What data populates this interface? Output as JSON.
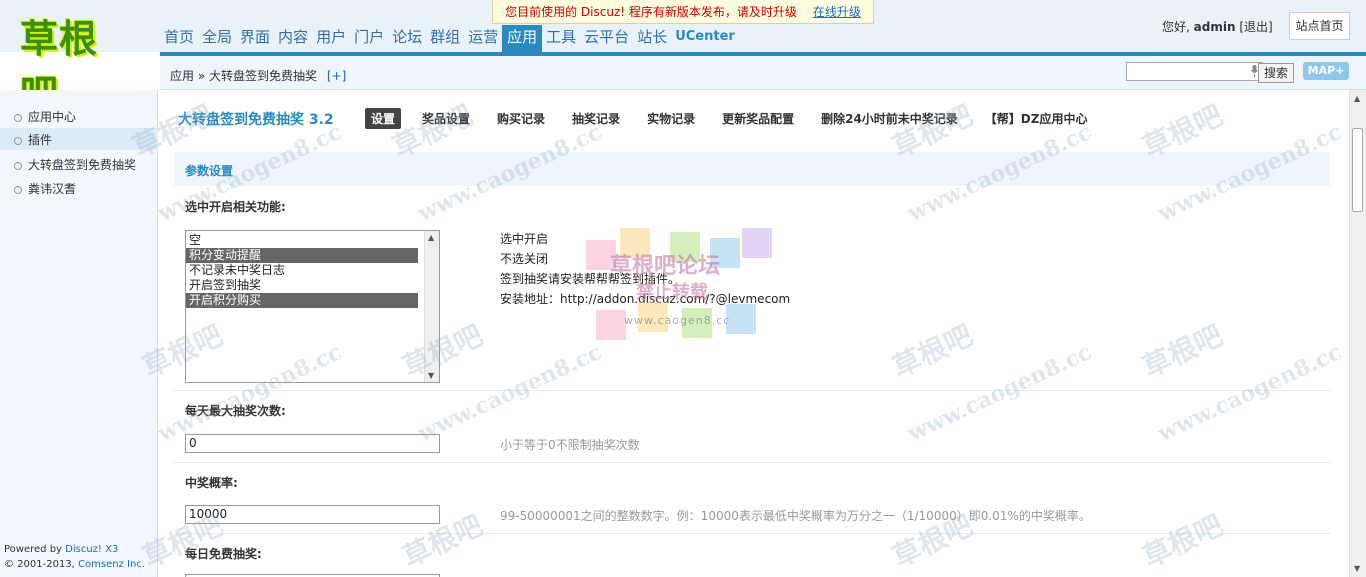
{
  "logo": {
    "text": "草根吧"
  },
  "notice": {
    "text": "您目前使用的 Discuz! 程序有新版本发布，请及时升级",
    "link": "在线升级"
  },
  "nav": {
    "items": [
      "首页",
      "全局",
      "界面",
      "内容",
      "用户",
      "门户",
      "论坛",
      "群组",
      "运营",
      "应用",
      "工具",
      "云平台",
      "站长"
    ],
    "uc": "UCenter",
    "active_index": 9
  },
  "user": {
    "greeting": "您好,",
    "name": "admin",
    "logout": "[退出]",
    "site_home": "站点首页"
  },
  "breadcrumb": {
    "root": "应用",
    "sep": "»",
    "current": "大转盘签到免费抽奖",
    "plus": "[+]"
  },
  "search": {
    "value": "",
    "button": "搜索",
    "map": "MAP+"
  },
  "sidebar": {
    "items": [
      "应用中心",
      "插件",
      "大转盘签到免费抽奖",
      "粪讳汉耆"
    ],
    "active_index": 1,
    "footer": {
      "powered": "Powered by",
      "discuz": "Discuz! X3",
      "copyright": "© 2001-2013,",
      "company": "Comsenz Inc."
    }
  },
  "plugin": {
    "title": "大转盘签到免费抽奖 3.2",
    "tabs": [
      "设置",
      "奖品设置",
      "购买记录",
      "抽奖记录",
      "实物记录",
      "更新奖品配置",
      "删除24小时前未中奖记录",
      "【帮】DZ应用中心"
    ],
    "active_tab": 0
  },
  "section": {
    "title": "参数设置"
  },
  "fields": {
    "features": {
      "label": "选中开启相关功能:",
      "options": [
        {
          "text": "空",
          "selected": false
        },
        {
          "text": "积分变动提醒",
          "selected": true
        },
        {
          "text": "不记录未中奖日志",
          "selected": false
        },
        {
          "text": "开启签到抽奖",
          "selected": false
        },
        {
          "text": "开启积分购买",
          "selected": true
        }
      ],
      "help": [
        "选中开启",
        "不选关闭",
        "签到抽奖请安装帮帮帮签到插件。",
        "安装地址：http://addon.discuz.com/?@levmecom"
      ]
    },
    "max_draws": {
      "label": "每天最大抽奖次数:",
      "value": "0",
      "tip": "小于等于0不限制抽奖次数"
    },
    "prob": {
      "label": "中奖概率:",
      "value": "10000",
      "tip": "99-50000001之间的整数数字。例：10000表示最低中奖概率为万分之一（1/10000）即0.01%的中奖概率。"
    },
    "daily_free": {
      "label": "每日免费抽奖:"
    }
  },
  "watermark": {
    "brand": "草根吧",
    "site": "www.caogen8.cc",
    "center": "草根吧论坛",
    "center_sub": "禁止转载",
    "center_url": "www.caogen8.cc"
  },
  "colors": {
    "accent": "#2a8ac0",
    "nav_text": "#2f6fab",
    "notice_red": "#cc0000"
  }
}
